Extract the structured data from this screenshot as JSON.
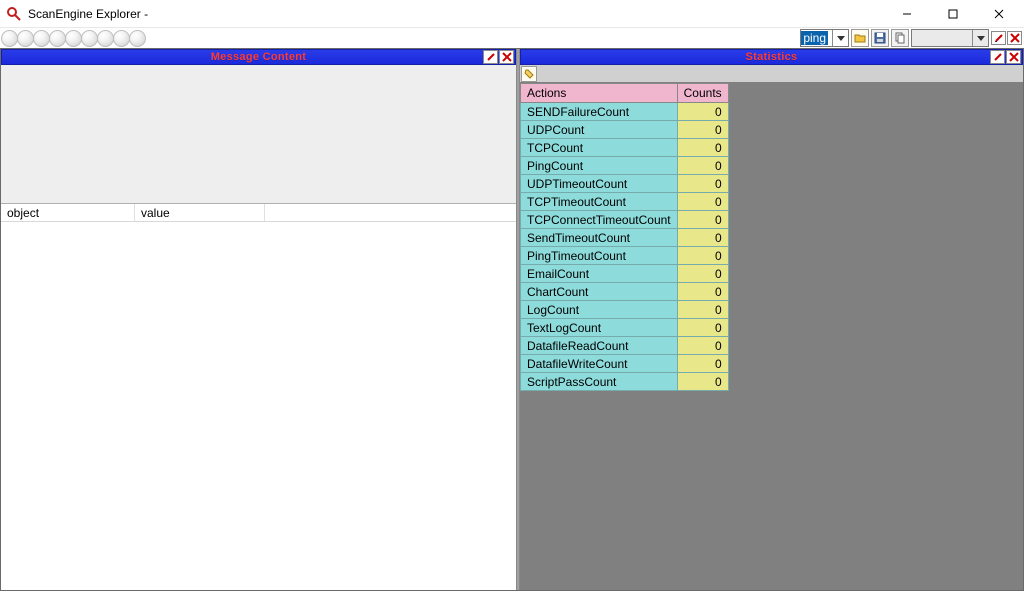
{
  "window": {
    "title": "ScanEngine Explorer -"
  },
  "toolbar": {
    "circle_count": 9,
    "combo1_value": "ping",
    "combo2_value": ""
  },
  "left_panel": {
    "title": "Message Content",
    "columns": {
      "object": "object",
      "value": "value"
    }
  },
  "right_panel": {
    "title": "Statistics",
    "headers": {
      "actions": "Actions",
      "counts": "Counts"
    },
    "rows": [
      {
        "action": "SENDFailureCount",
        "count": "0"
      },
      {
        "action": "UDPCount",
        "count": "0"
      },
      {
        "action": "TCPCount",
        "count": "0"
      },
      {
        "action": "PingCount",
        "count": "0"
      },
      {
        "action": "UDPTimeoutCount",
        "count": "0"
      },
      {
        "action": "TCPTimeoutCount",
        "count": "0"
      },
      {
        "action": "TCPConnectTimeoutCount",
        "count": "0"
      },
      {
        "action": "SendTimeoutCount",
        "count": "0"
      },
      {
        "action": "PingTimeoutCount",
        "count": "0"
      },
      {
        "action": "EmailCount",
        "count": "0"
      },
      {
        "action": "ChartCount",
        "count": "0"
      },
      {
        "action": "LogCount",
        "count": "0"
      },
      {
        "action": "TextLogCount",
        "count": "0"
      },
      {
        "action": "DatafileReadCount",
        "count": "0"
      },
      {
        "action": "DatafileWriteCount",
        "count": "0"
      },
      {
        "action": "ScriptPassCount",
        "count": "0"
      }
    ]
  }
}
